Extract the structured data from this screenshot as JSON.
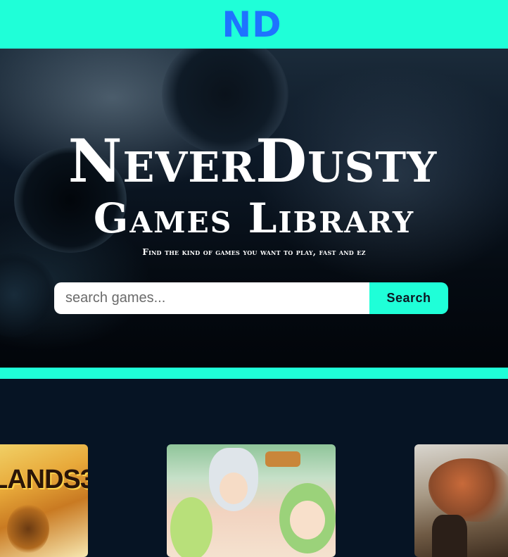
{
  "header": {
    "logo_text": "ND"
  },
  "hero": {
    "title": "NeverDusty",
    "subtitle": "Games Library",
    "tagline": "Find the kind of games you want to play, fast and ez"
  },
  "search": {
    "placeholder": "search games...",
    "value": "",
    "button_label": "Search"
  },
  "games": [
    {
      "art_text": "LANDS3"
    },
    {
      "art_text": ""
    },
    {
      "art_text": ""
    }
  ],
  "colors": {
    "accent": "#1fffd8",
    "logo": "#1e73ff",
    "page_background": "#061424"
  }
}
